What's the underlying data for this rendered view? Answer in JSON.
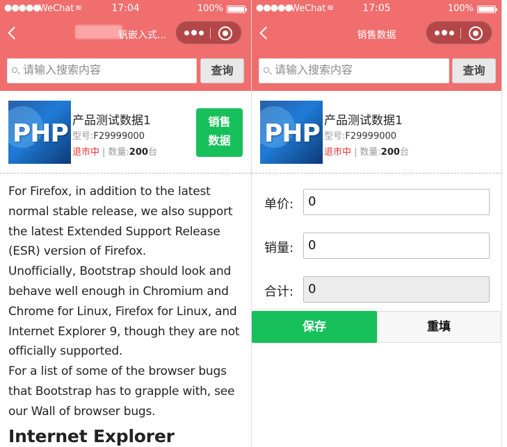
{
  "left": {
    "status": {
      "signal": "●●●●●",
      "carrier": "WeChat",
      "time": "17:04",
      "battery": "100%"
    },
    "nav": {
      "title": "钒嵌入式..."
    },
    "search": {
      "placeholder": "请输入搜索内容",
      "button": "查询"
    },
    "product": {
      "logo_text": "PHP",
      "name": "产品测试数据1",
      "model_label": "型号:",
      "model": "F29999000",
      "status": "退市中",
      "separator": "|",
      "qty_label": "数量:",
      "qty": "200",
      "unit": "台",
      "sales_button_line1": "销售",
      "sales_button_line2": "数据"
    },
    "article": {
      "p1": "For Firefox, in addition to the latest normal stable release, we also support the latest Extended Support Release (ESR) version of Firefox.",
      "p2": "Unofficially, Bootstrap should look and behave well enough in Chromium and Chrome for Linux, Firefox for Linux, and Internet Explorer 9, though they are not officially supported.",
      "p3": "For a list of some of the browser bugs that Bootstrap has to grapple with, see our Wall of browser bugs.",
      "heading": "Internet Explorer"
    }
  },
  "right": {
    "status": {
      "signal": "●●●●●",
      "carrier": "WeChat",
      "time": "17:05",
      "battery": "100%"
    },
    "nav": {
      "title": "销售数据"
    },
    "search": {
      "placeholder": "请输入搜索内容",
      "button": "查询"
    },
    "product": {
      "logo_text": "PHP",
      "name": "产品测试数据1",
      "model_label": "型号:",
      "model": "F29999000",
      "status": "退市中",
      "separator": "|",
      "qty_label": "数量:",
      "qty": "200",
      "unit": "台"
    },
    "form": {
      "price_label": "单价:",
      "price_value": "0",
      "volume_label": "销量:",
      "volume_value": "0",
      "total_label": "合计:",
      "total_value": "0",
      "save_button": "保存",
      "reset_button": "重填"
    }
  },
  "colors": {
    "header": "#f06e6e",
    "primary_green": "#17c05a",
    "status_red": "#e33333"
  },
  "icons": [
    "back-arrow-icon",
    "more-dots-icon",
    "close-circle-icon",
    "search-icon",
    "wifi-icon",
    "battery-icon"
  ]
}
